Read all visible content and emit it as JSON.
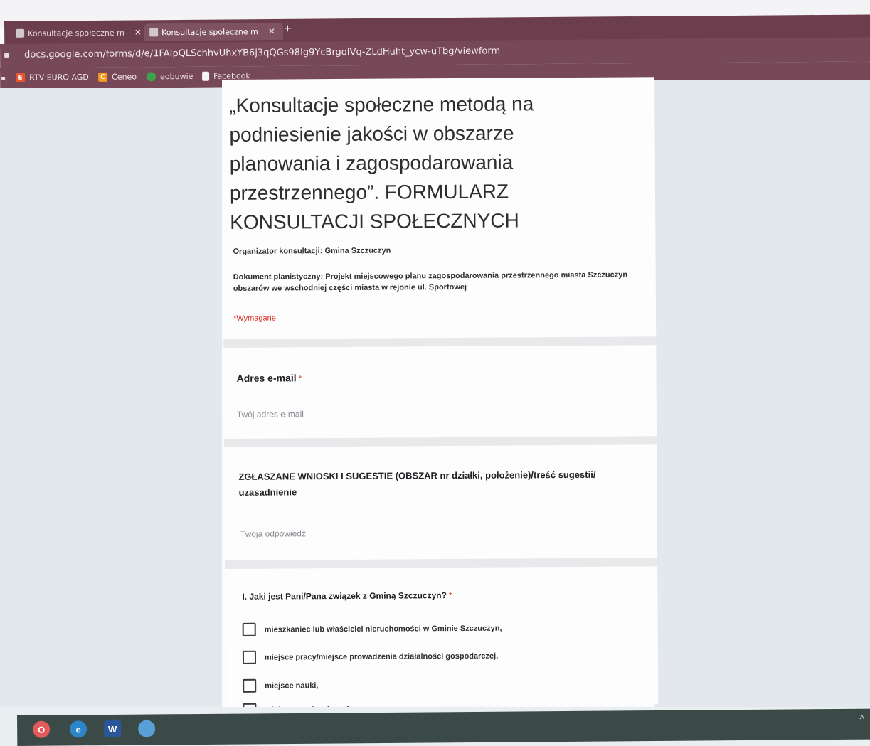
{
  "browser": {
    "tabs": [
      {
        "label": "Konsultacje społeczne m",
        "close": "✕"
      },
      {
        "label": "Konsultacje społeczne m",
        "close": "✕"
      }
    ],
    "new_tab": "+",
    "url": "docs.google.com/forms/d/e/1FAIpQLSchhvUhxYB6j3qQGs98Ig9YcBrgoIVq-ZLdHuht_ycw-uTbg/viewform",
    "bookmarks": [
      {
        "label": "RTV EURO AGD",
        "icon": "E",
        "color": "#e8542b"
      },
      {
        "label": "Ceneo",
        "icon": "C",
        "color": "#f39a1f"
      },
      {
        "label": "eobuwie",
        "icon": "",
        "color": "#3fa34d"
      },
      {
        "label": "Facebook",
        "icon": "",
        "color": "#f4f4f4"
      }
    ]
  },
  "form": {
    "title": "„Konsultacje społeczne metodą na podniesienie jakości w obszarze planowania i zagospodarowania przestrzennego”. FORMULARZ KONSULTACJI SPOŁECZNYCH",
    "organizer": "Organizator konsultacji: Gmina Szczuczyn",
    "document": "Dokument planistyczny: Projekt miejscowego planu zagospodarowania przestrzennego miasta Szczuczyn obszarów we wschodniej części miasta w rejonie ul. Sportowej",
    "required_note": "*Wymagane",
    "email": {
      "label": "Adres e-mail",
      "required_mark": "*",
      "placeholder": "Twój adres e-mail"
    },
    "q2": {
      "label": "ZGŁASZANE WNIOSKI I SUGESTIE (OBSZAR nr działki, położenie)/treść sugestii/ uzasadnienie",
      "placeholder": "Twoja odpowiedź"
    },
    "q3": {
      "label": "I. Jaki jest Pani/Pana związek z Gminą Szczuczyn?",
      "required_mark": "*",
      "options": [
        "mieszkaniec lub właściciel nieruchomości w Gminie Szczuczyn,",
        "miejsce pracy/miejsce prowadzenia działalności gospodarczej,",
        "miejsce nauki,",
        "miejsce spędzania wolnego czasu,"
      ]
    }
  },
  "taskbar": {
    "icons": [
      "opera-icon",
      "edge-icon",
      "word-icon",
      "chat-icon"
    ],
    "chevron": "^"
  },
  "colors": {
    "browser_chrome": "#764858",
    "required_red": "#d93025",
    "page_background": "#e3e7ee"
  }
}
